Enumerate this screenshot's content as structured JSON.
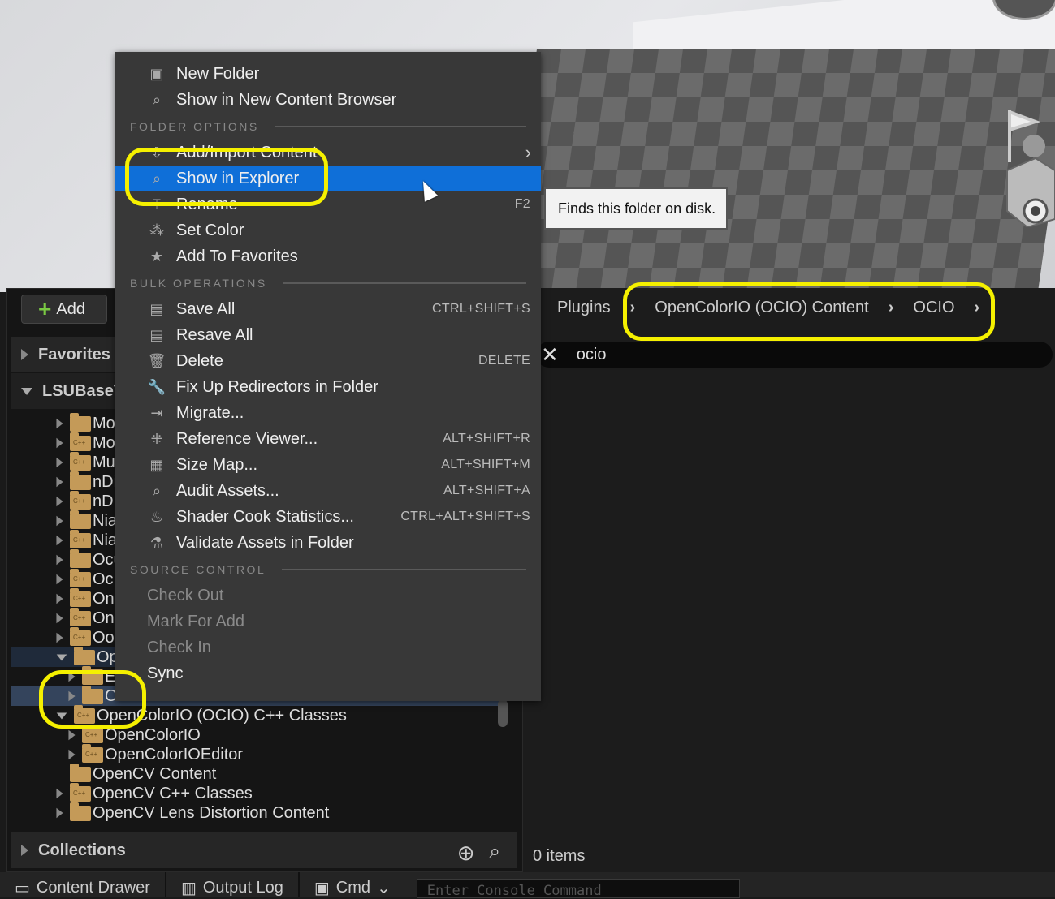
{
  "toolbar": {
    "add_label": "Add"
  },
  "sections": {
    "favorites": "Favorites",
    "root": "LSUBaseT",
    "collections": "Collections"
  },
  "tree": [
    {
      "label": "Mo",
      "cpp": false,
      "expanded": false,
      "depth": 1
    },
    {
      "label": "Mo",
      "cpp": true,
      "expanded": false,
      "depth": 1
    },
    {
      "label": "Mu",
      "cpp": true,
      "expanded": false,
      "depth": 1
    },
    {
      "label": "nDi",
      "cpp": false,
      "expanded": false,
      "depth": 1
    },
    {
      "label": "nD",
      "cpp": true,
      "expanded": false,
      "depth": 1
    },
    {
      "label": "Nia",
      "cpp": false,
      "expanded": false,
      "depth": 1
    },
    {
      "label": "Nia",
      "cpp": true,
      "expanded": false,
      "depth": 1
    },
    {
      "label": "Ocu",
      "cpp": false,
      "expanded": false,
      "depth": 1
    },
    {
      "label": "Oc",
      "cpp": true,
      "expanded": false,
      "depth": 1
    },
    {
      "label": "On",
      "cpp": true,
      "expanded": false,
      "depth": 1
    },
    {
      "label": "On",
      "cpp": true,
      "expanded": false,
      "depth": 1
    },
    {
      "label": "Oo",
      "cpp": true,
      "expanded": false,
      "depth": 1
    },
    {
      "label": "Ope",
      "cpp": false,
      "expanded": true,
      "depth": 1,
      "state": "parent"
    },
    {
      "label": "E",
      "cpp": false,
      "expanded": false,
      "depth": 2
    },
    {
      "label": "O",
      "cpp": false,
      "expanded": false,
      "depth": 2,
      "state": "selected"
    },
    {
      "label": "OpenColorIO (OCIO) C++ Classes",
      "cpp": true,
      "expanded": true,
      "depth": 1
    },
    {
      "label": "OpenColorIO",
      "cpp": true,
      "expanded": false,
      "depth": 2
    },
    {
      "label": "OpenColorIOEditor",
      "cpp": true,
      "expanded": false,
      "depth": 2
    },
    {
      "label": "OpenCV Content",
      "cpp": false,
      "expanded": null,
      "depth": 1
    },
    {
      "label": "OpenCV C++ Classes",
      "cpp": true,
      "expanded": false,
      "depth": 1
    },
    {
      "label": "OpenCV Lens Distortion Content",
      "cpp": false,
      "expanded": false,
      "depth": 1
    }
  ],
  "menu": {
    "items_top": [
      {
        "label": "New Folder",
        "icon": "new-folder-icon",
        "glyph": "▣"
      },
      {
        "label": "Show in New Content Browser",
        "icon": "folder-search-icon",
        "glyph": "⌕"
      }
    ],
    "folder_options_header": "FOLDER OPTIONS",
    "folder_options": [
      {
        "label": "Add/Import Content",
        "icon": "import-icon",
        "glyph": "⇩",
        "submenu": true
      },
      {
        "label": "Show in Explorer",
        "icon": "folder-search-icon",
        "glyph": "⌕",
        "highlighted": true
      },
      {
        "label": "Rename",
        "icon": "rename-icon",
        "glyph": "⌶",
        "shortcut": "F2"
      },
      {
        "label": "Set Color",
        "icon": "color-icon",
        "glyph": "⁂"
      },
      {
        "label": "Add To Favorites",
        "icon": "star-icon",
        "glyph": "★"
      }
    ],
    "bulk_header": "BULK OPERATIONS",
    "bulk": [
      {
        "label": "Save All",
        "icon": "save-icon",
        "glyph": "▤",
        "shortcut": "CTRL+SHIFT+S"
      },
      {
        "label": "Resave All",
        "icon": "save-icon",
        "glyph": "▤"
      },
      {
        "label": "Delete",
        "icon": "trash-icon",
        "glyph": "🗑",
        "shortcut": "DELETE"
      },
      {
        "label": "Fix Up Redirectors in Folder",
        "icon": "wrench-icon",
        "glyph": "🔧"
      },
      {
        "label": "Migrate...",
        "icon": "migrate-icon",
        "glyph": "⇥"
      },
      {
        "label": "Reference Viewer...",
        "icon": "reference-icon",
        "glyph": "⁜",
        "shortcut": "ALT+SHIFT+R"
      },
      {
        "label": "Size Map...",
        "icon": "size-map-icon",
        "glyph": "▦",
        "shortcut": "ALT+SHIFT+M"
      },
      {
        "label": "Audit Assets...",
        "icon": "audit-icon",
        "glyph": "⌕",
        "shortcut": "ALT+SHIFT+A"
      },
      {
        "label": "Shader Cook Statistics...",
        "icon": "shader-icon",
        "glyph": "♨",
        "shortcut": "CTRL+ALT+SHIFT+S"
      },
      {
        "label": "Validate Assets in Folder",
        "icon": "flask-icon",
        "glyph": "⚗"
      }
    ],
    "source_header": "SOURCE CONTROL",
    "source": [
      {
        "label": "Check Out",
        "disabled": true
      },
      {
        "label": "Mark For Add",
        "disabled": true
      },
      {
        "label": "Check In",
        "disabled": true
      },
      {
        "label": "Sync",
        "disabled": false
      }
    ]
  },
  "tooltip": "Finds this folder on disk.",
  "breadcrumbs": [
    "Plugins",
    "OpenColorIO (OCIO) Content",
    "OCIO"
  ],
  "search": {
    "value": "ocio"
  },
  "status": {
    "items": "0 items"
  },
  "bottom": {
    "content_drawer": "Content Drawer",
    "output_log": "Output Log",
    "cmd": "Cmd",
    "console_placeholder": "Enter Console Command"
  },
  "colors": {
    "highlight": "#0f6fd8",
    "annotation": "#f5f000",
    "add_plus": "#7ac943",
    "folder": "#c49a58"
  }
}
